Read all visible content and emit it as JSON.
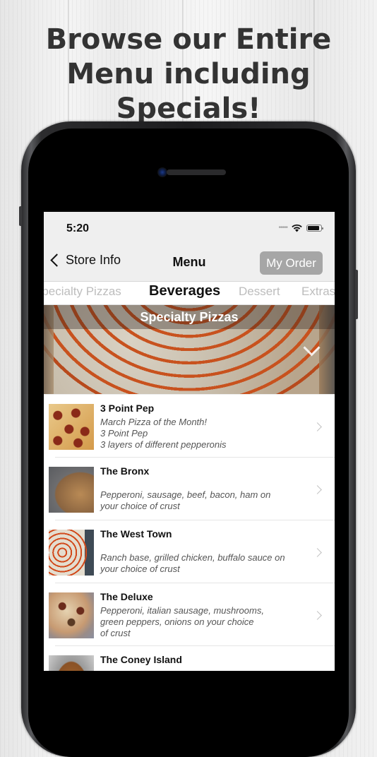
{
  "headline": {
    "lines": [
      "Browse our Entire",
      "Menu including",
      "Specials!"
    ]
  },
  "status_bar": {
    "time": "5:20",
    "icons": [
      "signal-dots-icon",
      "wifi-icon",
      "battery-icon"
    ],
    "battery_level": 0.9
  },
  "nav": {
    "back_label": "Store Info",
    "title": "Menu",
    "order_button": "My Order",
    "order_button_color": "#a6a6a6"
  },
  "categories": {
    "items": [
      {
        "label": "Specialty Pizzas",
        "active": false
      },
      {
        "label": "Beverages",
        "active": true
      },
      {
        "label": "Dessert",
        "active": false
      },
      {
        "label": "Extras",
        "active": false
      }
    ]
  },
  "banner": {
    "title": "Specialty Pizzas",
    "icon": "chevron-down-icon"
  },
  "menu_items": [
    {
      "name": "3 Point Pep",
      "desc": [
        "March Pizza of the Month!",
        "3 Point Pep",
        "3 layers of different pepperonis"
      ]
    },
    {
      "name": "The Bronx",
      "desc": [
        "Pepperoni, sausage, beef, bacon, ham on",
        "your choice of crust"
      ]
    },
    {
      "name": "The West Town",
      "desc": [
        "Ranch base, grilled chicken, buffalo sauce on",
        "your choice of crust"
      ]
    },
    {
      "name": "The Deluxe",
      "desc": [
        "Pepperoni, italian sausage, mushrooms,",
        "green peppers, onions on your choice",
        "of crust"
      ]
    },
    {
      "name": "The Coney Island",
      "desc": []
    }
  ]
}
